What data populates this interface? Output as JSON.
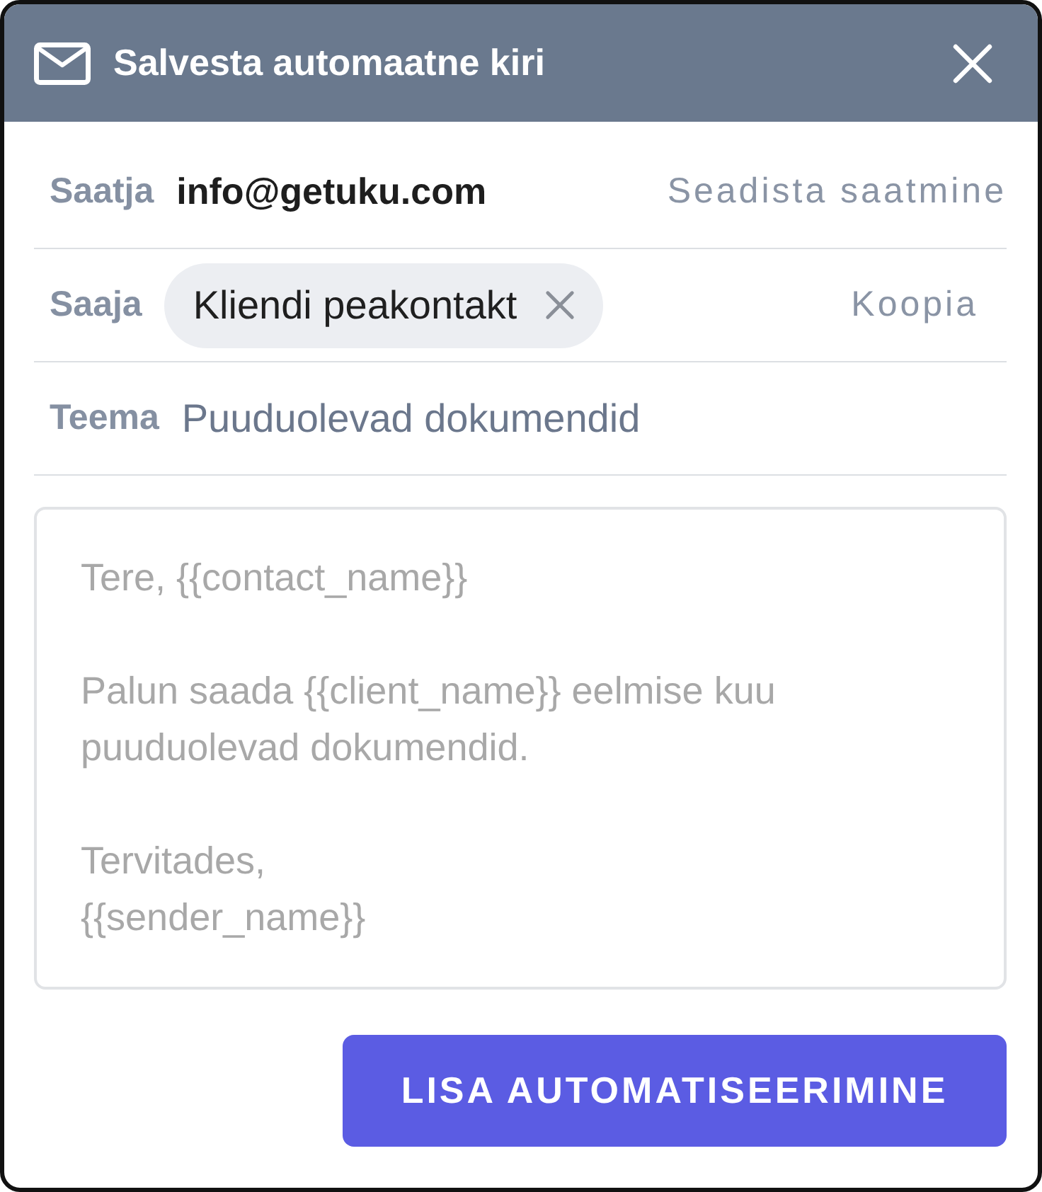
{
  "dialog": {
    "title": "Salvesta automaatne kiri"
  },
  "fields": [
    {
      "kind": "sender",
      "label": "Saatja",
      "value": "info@getuku.com",
      "action": "Seadista saatmine"
    },
    {
      "kind": "recipients",
      "label": "Saaja",
      "chips": [
        "Kliendi peakontakt"
      ],
      "action": "Koopia"
    },
    {
      "kind": "subject",
      "label": "Teema",
      "value": "Puuduolevad dokumendid"
    }
  ],
  "message": {
    "placeholder": [
      [
        "Tere, {{contact_name}}"
      ],
      [
        "Palun saada {{client_name}} eelmise kuu",
        "puuduolevad dokumendid."
      ],
      [
        "Tervitades,",
        "{{sender_name}}"
      ]
    ]
  },
  "buttons": [
    {
      "label": "LISA AUTOMATISEERIMINE"
    }
  ]
}
